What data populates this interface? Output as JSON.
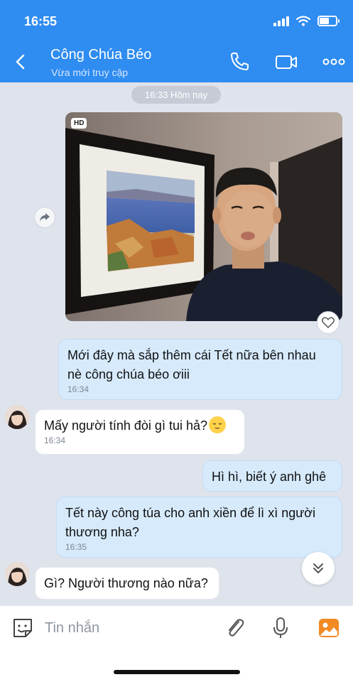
{
  "status_bar": {
    "time": "16:55",
    "battery_level": 0.6
  },
  "header": {
    "title": "Công Chúa Béo",
    "subtitle": "Vừa mới truy cập",
    "background": "#2f8cf0"
  },
  "chat": {
    "date_separator": "16:33 Hôm nay",
    "photo": {
      "badge": "HD"
    },
    "messages": [
      {
        "direction": "sent",
        "lines": [
          "Mới đây mà sắp thêm cái Tết nữa bên nhau",
          "nè công chúa béo ơiii"
        ],
        "time": "16:34"
      },
      {
        "direction": "received",
        "text": "Mấy người tính đòi gì tui hả?",
        "time": "16:34",
        "emoji": "relieved-face"
      },
      {
        "direction": "sent",
        "text": "Hì hì, biết ý anh ghê"
      },
      {
        "direction": "sent",
        "lines": [
          "Tết này công túa cho anh xiền để lì xì người",
          "thương nha?"
        ],
        "time": "16:35"
      },
      {
        "direction": "received",
        "text": "Gì? Người thương nào nữa?"
      }
    ]
  },
  "input": {
    "placeholder": "Tin nhắn"
  },
  "colors": {
    "accent": "#2f8cf0",
    "sent_bubble": "#d6eafc",
    "received_bubble": "#ffffff",
    "chat_background": "#dfe3ec"
  }
}
